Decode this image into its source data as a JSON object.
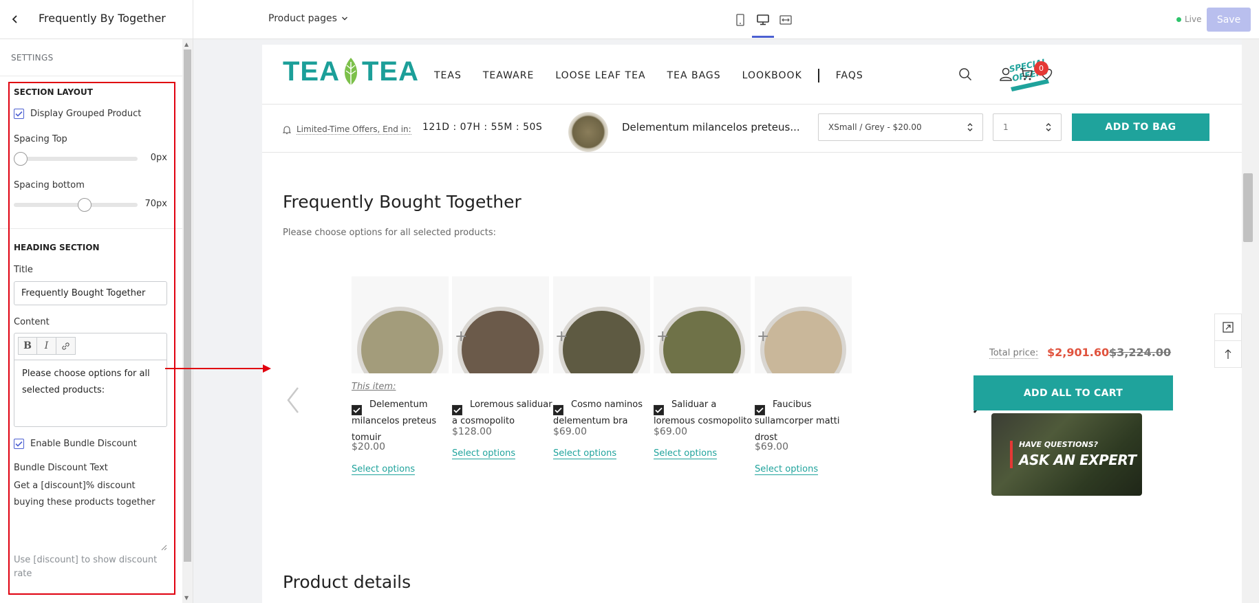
{
  "editor": {
    "panel_title": "Frequently By Together",
    "page_selector": "Product pages",
    "live_label": "Live",
    "save_label": "Save"
  },
  "settings": {
    "header": "SETTINGS",
    "section_layout": {
      "heading": "SECTION LAYOUT",
      "display_grouped_label": "Display Grouped Product",
      "display_grouped_checked": true,
      "spacing_top_label": "Spacing Top",
      "spacing_top_value": "0px",
      "spacing_top_level": 0,
      "spacing_bottom_label": "Spacing bottom",
      "spacing_bottom_value": "70px",
      "spacing_bottom_level": 0.58
    },
    "heading_section": {
      "heading": "HEADING SECTION",
      "title_label": "Title",
      "title_value": "Frequently Bought Together",
      "content_label": "Content",
      "content_value": "Please choose options for all selected products:",
      "enable_bundle_label": "Enable Bundle Discount",
      "enable_bundle_checked": true,
      "bundle_text_label": "Bundle Discount Text",
      "bundle_text_value": "Get a [discount]% discount buying these products together",
      "help_text": "Use [discount] to show discount rate"
    }
  },
  "store": {
    "nav": [
      "TEAS",
      "TEAWARE",
      "LOOSE LEAF TEA",
      "TEA BAGS",
      "LOOKBOOK",
      "FAQS"
    ],
    "cart_count": "0",
    "special_offers_badge": "SPECIAL OFFERS",
    "offer_label": "Limited-Time Offers, End in:",
    "countdown": "121D : 07H : 55M : 50S",
    "sticky_product_name": "Delementum milancelos preteus...",
    "variant_value": "XSmall / Grey - $20.00",
    "quantity": "1",
    "add_to_bag": "ADD TO BAG",
    "fbt_title": "Frequently Bought Together",
    "fbt_subtitle": "Please choose options for all selected products:",
    "this_item_label": "This item:",
    "products": [
      {
        "name": "Delementum milancelos preteus tomuir",
        "price": "$20.00",
        "select": "Select options",
        "tea": "#a39c7b"
      },
      {
        "name": "Loremous saliduar a cosmopolito",
        "price": "$128.00",
        "select": "Select options",
        "tea": "#6b5a4a"
      },
      {
        "name": "Cosmo naminos delementum bra",
        "price": "$69.00",
        "select": "Select options",
        "tea": "#5e5a42"
      },
      {
        "name": "Saliduar a loremous cosmopolito",
        "price": "$69.00",
        "select": "Select options",
        "tea": "#6f7248"
      },
      {
        "name": "Faucibus sullamcorper matti drost",
        "price": "$69.00",
        "select": "Select options",
        "tea": "#c9b79a"
      }
    ],
    "total_label": "Total price:",
    "total_price": "$2,901.60",
    "total_old_price": "$3,224.00",
    "add_all_label": "ADD ALL TO CART",
    "expert_question": "HAVE QUESTIONS?",
    "expert_title": "ASK AN EXPERT",
    "details_title": "Product details"
  },
  "colors": {
    "accent": "#1fa39c",
    "price_red": "#e0533e",
    "highlight": "#e0000f",
    "editor_blue": "#4b5fd1"
  }
}
